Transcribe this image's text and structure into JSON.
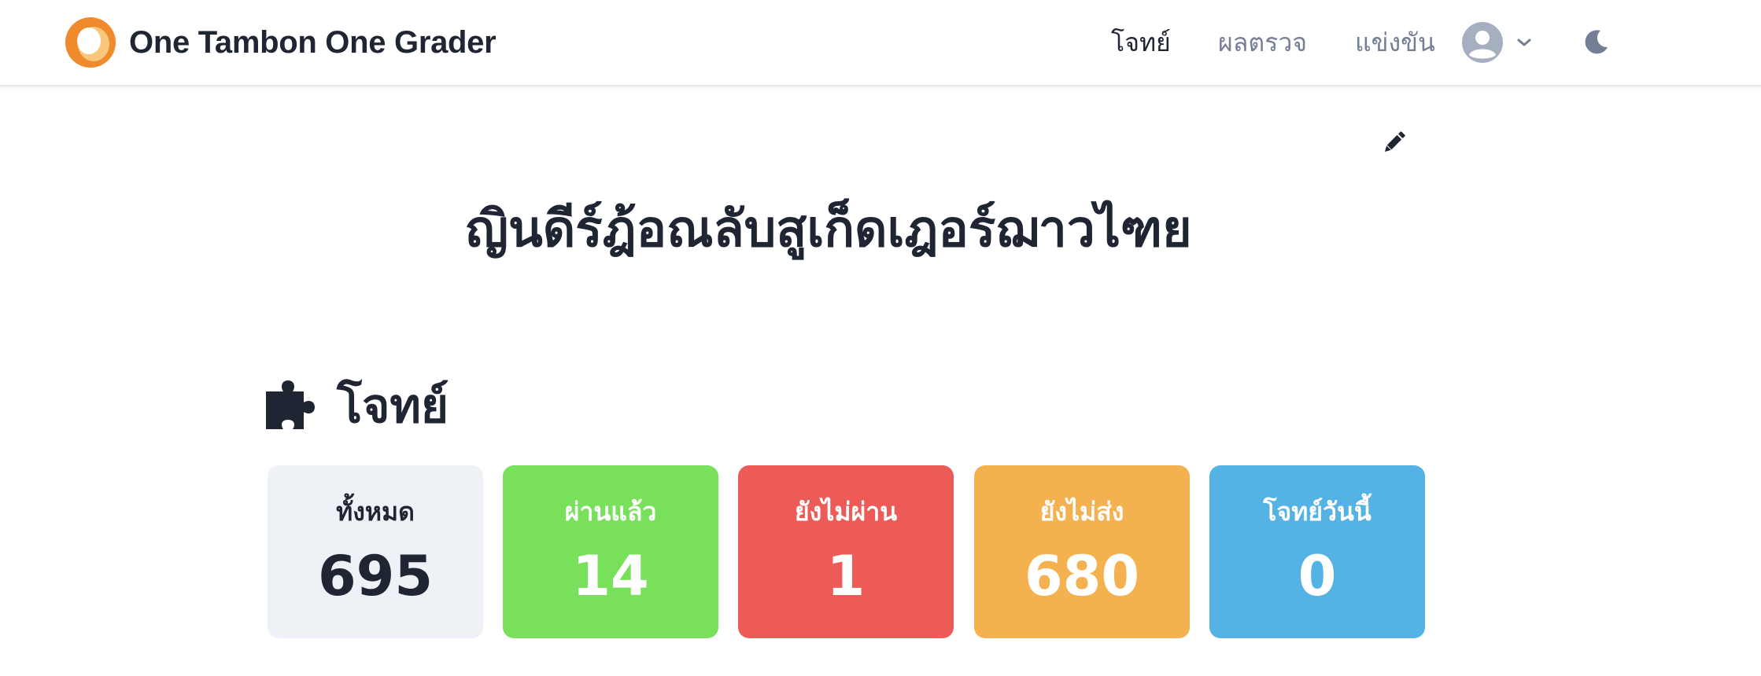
{
  "navbar": {
    "brand": "One Tambon One Grader",
    "links": [
      {
        "label": "โจทย์",
        "active": true
      },
      {
        "label": "ผลตรวจ",
        "active": false
      },
      {
        "label": "แข่งขัน",
        "active": false
      }
    ],
    "icons": {
      "logo": "otog-ring-logo",
      "avatar": "user-avatar-icon",
      "menu": "chevron-down-icon",
      "theme": "moon-icon"
    }
  },
  "page": {
    "title": "ญินดีร์ฎ้อณลับสูเก็ดเฎอร์ฌาวไฑย",
    "edit_icon": "pencil-icon"
  },
  "tasks_section": {
    "title": "โจทย์",
    "icon": "puzzle-icon",
    "stats": [
      {
        "label": "ทั้งหมด",
        "value": "695",
        "color": "#eef1f5"
      },
      {
        "label": "ผ่านแล้ว",
        "value": "14",
        "color": "#78e05a"
      },
      {
        "label": "ยังไม่ผ่าน",
        "value": "1",
        "color": "#ec5b58"
      },
      {
        "label": "ยังไม่ส่ง",
        "value": "680",
        "color": "#f3b24f"
      },
      {
        "label": "โจทย์วันนี้",
        "value": "0",
        "color": "#55b2e5"
      }
    ]
  },
  "colors": {
    "text_dark": "#1f2533",
    "text_muted": "#747e95",
    "logo_orange": "#ef8a2d",
    "logo_light": "#f9c77c"
  }
}
